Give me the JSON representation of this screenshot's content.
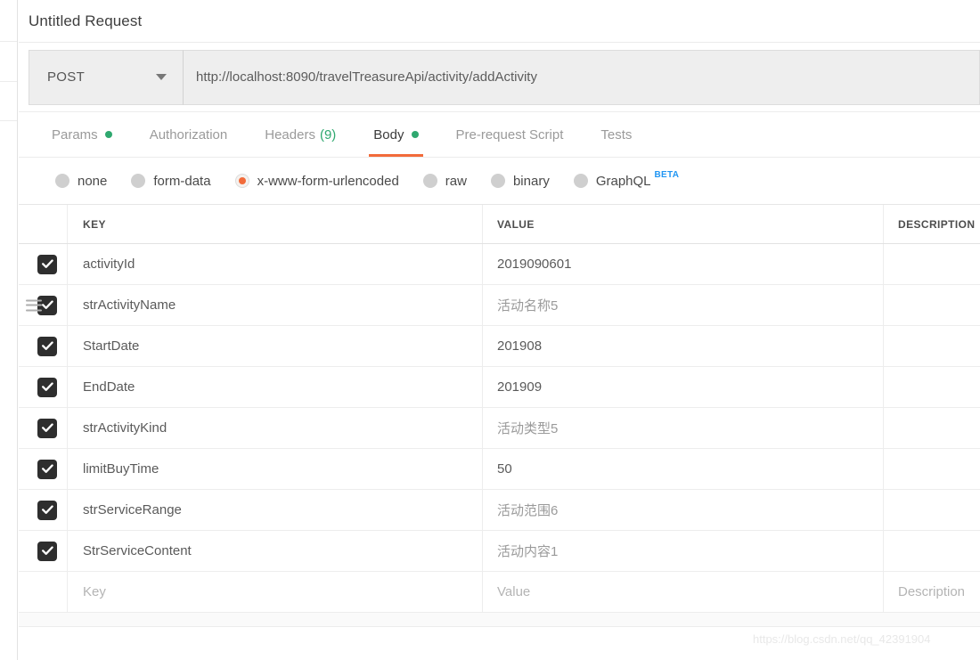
{
  "request": {
    "title": "Untitled Request",
    "method": "POST",
    "url": "http://localhost:8090/travelTreasureApi/activity/addActivity"
  },
  "tabs": [
    {
      "label": "Params",
      "dot": true,
      "count": "",
      "active": false
    },
    {
      "label": "Authorization",
      "dot": false,
      "count": "",
      "active": false
    },
    {
      "label": "Headers",
      "dot": false,
      "count": "(9)",
      "active": false
    },
    {
      "label": "Body",
      "dot": true,
      "count": "",
      "active": true
    },
    {
      "label": "Pre-request Script",
      "dot": false,
      "count": "",
      "active": false
    },
    {
      "label": "Tests",
      "dot": false,
      "count": "",
      "active": false
    }
  ],
  "body_types": [
    {
      "label": "none",
      "selected": false,
      "badge": ""
    },
    {
      "label": "form-data",
      "selected": false,
      "badge": ""
    },
    {
      "label": "x-www-form-urlencoded",
      "selected": true,
      "badge": ""
    },
    {
      "label": "raw",
      "selected": false,
      "badge": ""
    },
    {
      "label": "binary",
      "selected": false,
      "badge": ""
    },
    {
      "label": "GraphQL",
      "selected": false,
      "badge": "BETA"
    }
  ],
  "table": {
    "headers": {
      "key": "KEY",
      "value": "VALUE",
      "description": "DESCRIPTION"
    },
    "rows": [
      {
        "checked": true,
        "handle": false,
        "key": "activityId",
        "value": "2019090601",
        "value_cjk": false,
        "description": ""
      },
      {
        "checked": true,
        "handle": true,
        "key": "strActivityName",
        "value": "活动名称5",
        "value_cjk": true,
        "description": ""
      },
      {
        "checked": true,
        "handle": false,
        "key": "StartDate",
        "value": "201908",
        "value_cjk": false,
        "description": ""
      },
      {
        "checked": true,
        "handle": false,
        "key": "EndDate",
        "value": "201909",
        "value_cjk": false,
        "description": ""
      },
      {
        "checked": true,
        "handle": false,
        "key": "strActivityKind",
        "value": "活动类型5",
        "value_cjk": true,
        "description": ""
      },
      {
        "checked": true,
        "handle": false,
        "key": "limitBuyTime",
        "value": "50",
        "value_cjk": false,
        "description": ""
      },
      {
        "checked": true,
        "handle": false,
        "key": "strServiceRange",
        "value": "活动范围6",
        "value_cjk": true,
        "description": ""
      },
      {
        "checked": true,
        "handle": false,
        "key": "StrServiceContent",
        "value": "活动内容1",
        "value_cjk": true,
        "description": ""
      }
    ],
    "placeholder_row": {
      "key": "Key",
      "value": "Value",
      "description": "Description"
    }
  },
  "watermark": "https://blog.csdn.net/qq_42391904",
  "colors": {
    "accent_orange": "#f26b3a",
    "status_green": "#2fa86f",
    "beta_blue": "#2196f3",
    "checkbox_dark": "#2e2e2e"
  }
}
